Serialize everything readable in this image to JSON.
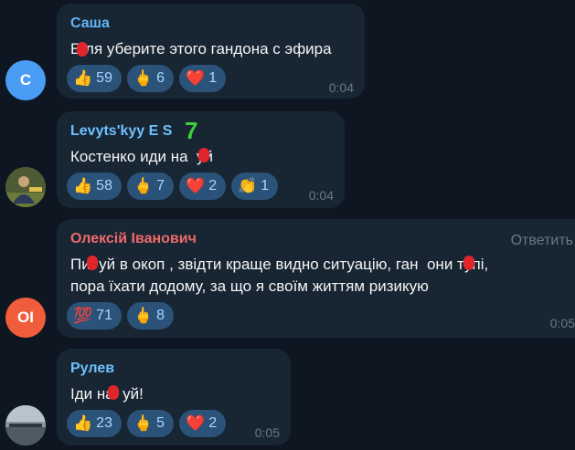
{
  "messages": [
    {
      "sender": "Саша",
      "sender_color": "#64b5f6",
      "avatar_letter": "С",
      "avatar_color": "#4b9cf5",
      "text": "Вот ля уберите этого гандона с эфира",
      "text_display": "Е ля уберите этого гандона с эфира",
      "reactions": [
        {
          "emoji": "👍",
          "count": "59"
        },
        {
          "emoji": "🖕",
          "count": "6"
        },
        {
          "emoji": "❤️",
          "count": "1"
        }
      ],
      "time": "0:04"
    },
    {
      "sender": "Levyts'kyy E S",
      "sender_color": "#6ec1ff",
      "sender_badge": "7",
      "avatar_letter": "",
      "avatar_color": "#3c4a2c",
      "text": "Костенко иди на  уй",
      "reactions": [
        {
          "emoji": "👍",
          "count": "58"
        },
        {
          "emoji": "🖕",
          "count": "7"
        },
        {
          "emoji": "❤️",
          "count": "2"
        },
        {
          "emoji": "👏",
          "count": "1"
        }
      ],
      "time": "0:04"
    },
    {
      "sender": "Олексій Іванович",
      "sender_color": "#ef6a6a",
      "reply_label": "Ответить",
      "avatar_letter": "OI",
      "avatar_color": "#f05d3a",
      "text_line1": "Пи  уй в окоп , звідти краще видно ситуацію, ган  они тупі,",
      "text_line2": "пора їхати додому, за що я своїм життям ризикую",
      "reactions": [
        {
          "emoji": "💯",
          "count": "71"
        },
        {
          "emoji": "🖕",
          "count": "8"
        }
      ],
      "time": "0:05"
    },
    {
      "sender": "Рулев",
      "sender_color": "#6ec1ff",
      "avatar_letter": "",
      "avatar_color": "#5a6570",
      "text": "Іди на  уй!",
      "reactions": [
        {
          "emoji": "👍",
          "count": "23"
        },
        {
          "emoji": "🖕",
          "count": "5"
        },
        {
          "emoji": "❤️",
          "count": "2"
        }
      ],
      "time": "0:05"
    }
  ]
}
